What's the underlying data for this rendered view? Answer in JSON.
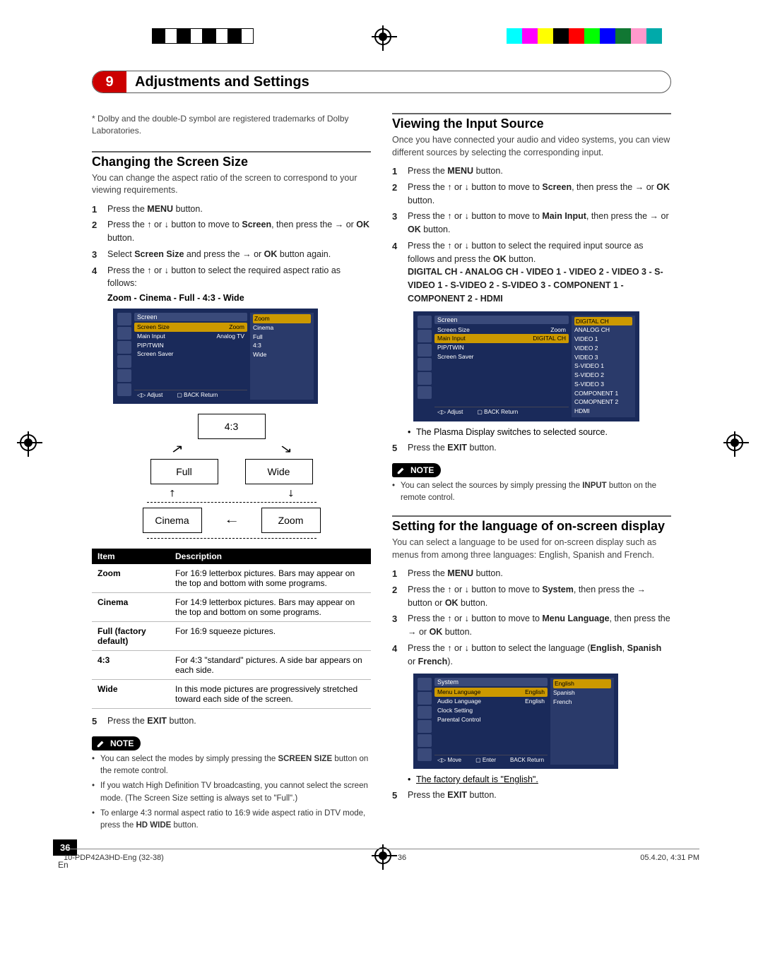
{
  "chapter": {
    "num": "9",
    "title": "Adjustments and Settings"
  },
  "footnote": "* Dolby and the double-D symbol are registered trademarks of Dolby Laboratories.",
  "left": {
    "section1": {
      "title": "Changing the Screen Size",
      "desc": "You can change the aspect ratio of the screen to correspond to your viewing requirements.",
      "steps": [
        {
          "pre": "Press the ",
          "bold": "MENU",
          "post": " button."
        },
        {
          "pre": "Press the ↑ or ↓ button to move to ",
          "bold": "Screen",
          "post": ", then press the → or ",
          "bold2": "OK",
          "post2": " button."
        },
        {
          "pre": "Select ",
          "bold": "Screen Size",
          "post": " and press the → or ",
          "bold2": "OK",
          "post2": " button again."
        },
        {
          "pre": "Press the ↑ or ↓ button to select the required aspect ratio as follows:"
        }
      ],
      "cycle": "Zoom - Cinema - Full - 4:3 - Wide"
    },
    "osd1": {
      "title": "Screen",
      "rows": [
        {
          "l": "Screen Size",
          "r": "Zoom",
          "hl": true
        },
        {
          "l": "Main Input",
          "r": "Analog TV"
        },
        {
          "l": "PIP/TWIN",
          "r": ""
        },
        {
          "l": "Screen Saver",
          "r": ""
        }
      ],
      "side": [
        "Zoom",
        "Cinema",
        "Full",
        "4:3",
        "Wide"
      ],
      "footer": {
        "l": "Adjust",
        "r": "Return"
      }
    },
    "flow": {
      "a": "4:3",
      "b": "Full",
      "c": "Wide",
      "d": "Cinema",
      "e": "Zoom"
    },
    "table": {
      "head": [
        "Item",
        "Description"
      ],
      "rows": [
        [
          "Zoom",
          "For 16:9 letterbox pictures. Bars may appear on the top and bottom with some programs."
        ],
        [
          "Cinema",
          "For 14:9 letterbox pictures. Bars may appear on the top and bottom on some programs."
        ],
        [
          "Full (factory default)",
          "For 16:9 squeeze pictures."
        ],
        [
          "4:3",
          "For 4:3 \"standard\" pictures. A side bar appears on each side."
        ],
        [
          "Wide",
          "In this mode pictures are progressively stretched toward each side of the screen."
        ]
      ]
    },
    "step5": {
      "pre": "Press the ",
      "bold": "EXIT",
      "post": " button."
    },
    "note_label": "NOTE",
    "notes": [
      "You can select the modes by simply pressing the SCREEN SIZE button on the remote control.",
      "If you watch High Definition TV broadcasting, you cannot select the screen mode. (The Screen Size setting is always set to \"Full\".)",
      "To enlarge 4:3 normal aspect ratio to 16:9 wide aspect ratio in DTV mode, press the HD WIDE button."
    ]
  },
  "right": {
    "section2": {
      "title": "Viewing the Input Source",
      "desc": "Once you have connected your audio and video systems, you can view different sources by selecting the corresponding input.",
      "steps": [
        "Press the MENU button.",
        "Press the ↑ or ↓ button to move to Screen, then press the → or OK button.",
        "Press the ↑ or ↓ button to move to Main Input, then press the → or OK button.",
        "Press the ↑ or ↓ button to select the required input source as follows and press the OK button."
      ],
      "sources_line": "DIGITAL CH - ANALOG CH - VIDEO 1 - VIDEO 2 - VIDEO 3 - S-VIDEO 1 - S-VIDEO 2 - S-VIDEO 3 - COMPONENT 1 - COMPONENT 2 - HDMI"
    },
    "osd2": {
      "title": "Screen",
      "rows": [
        {
          "l": "Screen Size",
          "r": "Zoom"
        },
        {
          "l": "Main Input",
          "r": "DIGITAL CH",
          "hl": true
        },
        {
          "l": "PIP/TWIN",
          "r": ""
        },
        {
          "l": "Screen Saver",
          "r": ""
        }
      ],
      "side": [
        "DIGITAL CH",
        "ANALOG CH",
        "VIDEO 1",
        "VIDEO 2",
        "VIDEO 3",
        "S-VIDEO 1",
        "S-VIDEO 2",
        "S-VIDEO 3",
        "COMPONENT 1",
        "COMOPNENT 2",
        "HDMI"
      ],
      "footer": {
        "l": "Adjust",
        "r": "Return"
      }
    },
    "sub_bullet2": "The Plasma Display switches to selected source.",
    "step5b": {
      "pre": "Press the ",
      "bold": "EXIT",
      "post": " button."
    },
    "note2": "You can select the sources by simply pressing the INPUT button on the remote control.",
    "section3": {
      "title": "Setting for the language of on-screen display",
      "desc": "You can select a language to be used for on-screen display such as menus from among three languages: English, Spanish and French.",
      "steps": [
        "Press the MENU button.",
        "Press the ↑ or ↓ button to move to System, then press the → button or OK button.",
        "Press the ↑ or ↓ button to move to Menu Language, then press the → or OK button.",
        "Press the ↑ or ↓ button to select the language (English, Spanish or French)."
      ]
    },
    "osd3": {
      "title": "System",
      "rows": [
        {
          "l": "Menu Language",
          "r": "English",
          "hl": true
        },
        {
          "l": "Audio Language",
          "r": "English"
        },
        {
          "l": "Clock Setting",
          "r": ""
        },
        {
          "l": "Parental Control",
          "r": ""
        }
      ],
      "side": [
        "English",
        "Spanish",
        "French"
      ],
      "footer": {
        "l": "Move",
        "m": "Enter",
        "r": "Return"
      }
    },
    "sub_bullet3": "The factory default is \"English\".",
    "step5c": {
      "pre": "Press the ",
      "bold": "EXIT",
      "post": " button."
    }
  },
  "page": {
    "num": "36",
    "lang": "En"
  },
  "footer": {
    "l": "10-PDP42A3HD-Eng (32-38)",
    "m": "36",
    "r": "05.4.20, 4:31 PM"
  },
  "color_bar": [
    "#fff",
    "#000",
    "#fff",
    "#000",
    "#fff",
    "#000",
    "#fff",
    "#000",
    "#fff",
    "#fff",
    "#fff",
    "#fff",
    "#fff",
    "#fff",
    "#fff",
    "#fff",
    "#fff",
    "#fff",
    "#0ff",
    "#f0f",
    "#ff0",
    "#000",
    "#f00",
    "#0f0",
    "#00f",
    "#061",
    "#fac",
    "#0aa",
    "#fff"
  ]
}
